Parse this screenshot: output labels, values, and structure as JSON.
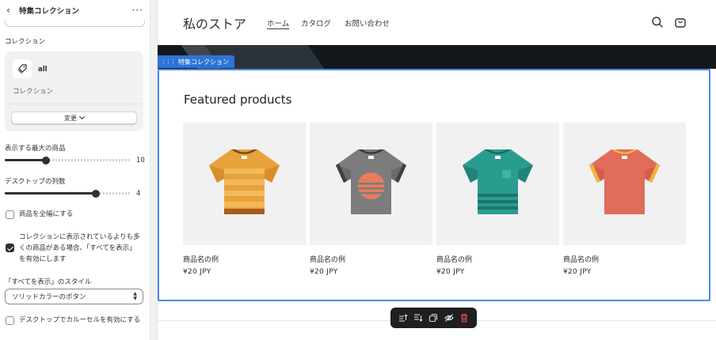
{
  "sidebar": {
    "title": "特集コレクション",
    "collection_label": "コレクション",
    "collection": {
      "name": "all",
      "type": "コレクション",
      "change_label": "変更"
    },
    "max_products": {
      "label": "表示する最大の商品",
      "value": "10",
      "fraction": 0.33
    },
    "desktop_columns": {
      "label": "デスクトップの列数",
      "value": "4",
      "fraction": 0.73
    },
    "full_width": {
      "label": "商品を全幅にする",
      "checked": false
    },
    "view_all": {
      "label_lines": [
        "コレクションに表示されているよりも多",
        "くの商品がある場合、「すべてを表示」",
        "を有効にします"
      ],
      "checked": true
    },
    "view_all_style": {
      "label": "「すべてを表示」のスタイル",
      "value": "ソリッドカラーのボタン"
    },
    "carousel": {
      "label": "デスクトップでカルーセルを有効にする",
      "checked": false
    }
  },
  "store": {
    "logo": "私のストア",
    "nav": [
      "ホーム",
      "カタログ",
      "お問い合わせ"
    ],
    "section_tag": "特集コレクション",
    "section_title": "Featured products",
    "products": [
      {
        "title": "商品名の例",
        "price": "¥20 JPY",
        "shirt": "orange-striped"
      },
      {
        "title": "商品名の例",
        "price": "¥20 JPY",
        "shirt": "gray-sunset"
      },
      {
        "title": "商品名の例",
        "price": "¥20 JPY",
        "shirt": "teal-pocket"
      },
      {
        "title": "商品名の例",
        "price": "¥20 JPY",
        "shirt": "coral-plain"
      }
    ]
  },
  "icons": {
    "back": "chevron-left-icon",
    "more": "more-horizontal-icon",
    "search": "search-icon",
    "cart": "cart-icon",
    "toolbar": [
      "move-up-icon",
      "move-down-icon",
      "duplicate-icon",
      "hide-icon",
      "delete-icon"
    ]
  },
  "colors": {
    "accent": "#2e74d6",
    "section_outline": "#4a8ae6",
    "toolbar_bg": "#1f1f1f",
    "delete": "#e5484d"
  }
}
